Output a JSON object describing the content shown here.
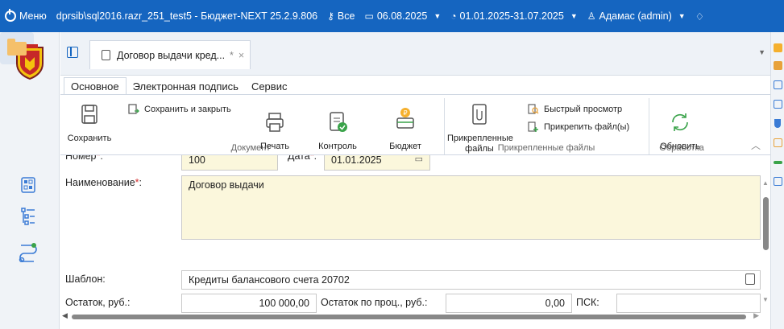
{
  "topbar": {
    "menu_label": "Меню",
    "connection": "dprsib\\sql2016.razr_251_test5 - Бюджет-NEXT 25.2.9.806",
    "scope": "Все",
    "date": "06.08.2025",
    "period": "01.01.2025-31.07.2025",
    "user": "Адамас (admin)",
    "bg_color": "#1565c0"
  },
  "tab": {
    "title": "Договор выдачи кред...",
    "modified": "*",
    "close": "×"
  },
  "ribbon": {
    "tabs": [
      "Основное",
      "Электронная подпись",
      "Сервис"
    ],
    "save": "Сохранить",
    "save_close": "Сохранить и закрыть",
    "print": "Печать",
    "control": "Контроль",
    "budget": "Бюджет",
    "attached_files_line1": "Прикрепленные",
    "attached_files_line2": "файлы",
    "quick_view": "Быстрый просмотр",
    "attach_files": "Прикрепить файл(ы)",
    "refresh": "Обновить",
    "groups": {
      "document": "Документ",
      "attached_files": "Прикрепленные файлы",
      "processing": "Обработка"
    }
  },
  "form": {
    "number_label": "Номер",
    "number_value": "100",
    "date_label": "Дата",
    "date_value": "01.01.2025",
    "name_label": "Наименование",
    "name_value": "Договор выдачи",
    "template_label": "Шаблон:",
    "template_value": "Кредиты балансового счета 20702",
    "balance_label": "Остаток, руб.:",
    "balance_value": "100 000,00",
    "interest_balance_label": "Остаток по проц., руб.:",
    "interest_balance_value": "0,00",
    "psk_label": "ПСК:",
    "required_mark": "*",
    "colon": ":"
  }
}
